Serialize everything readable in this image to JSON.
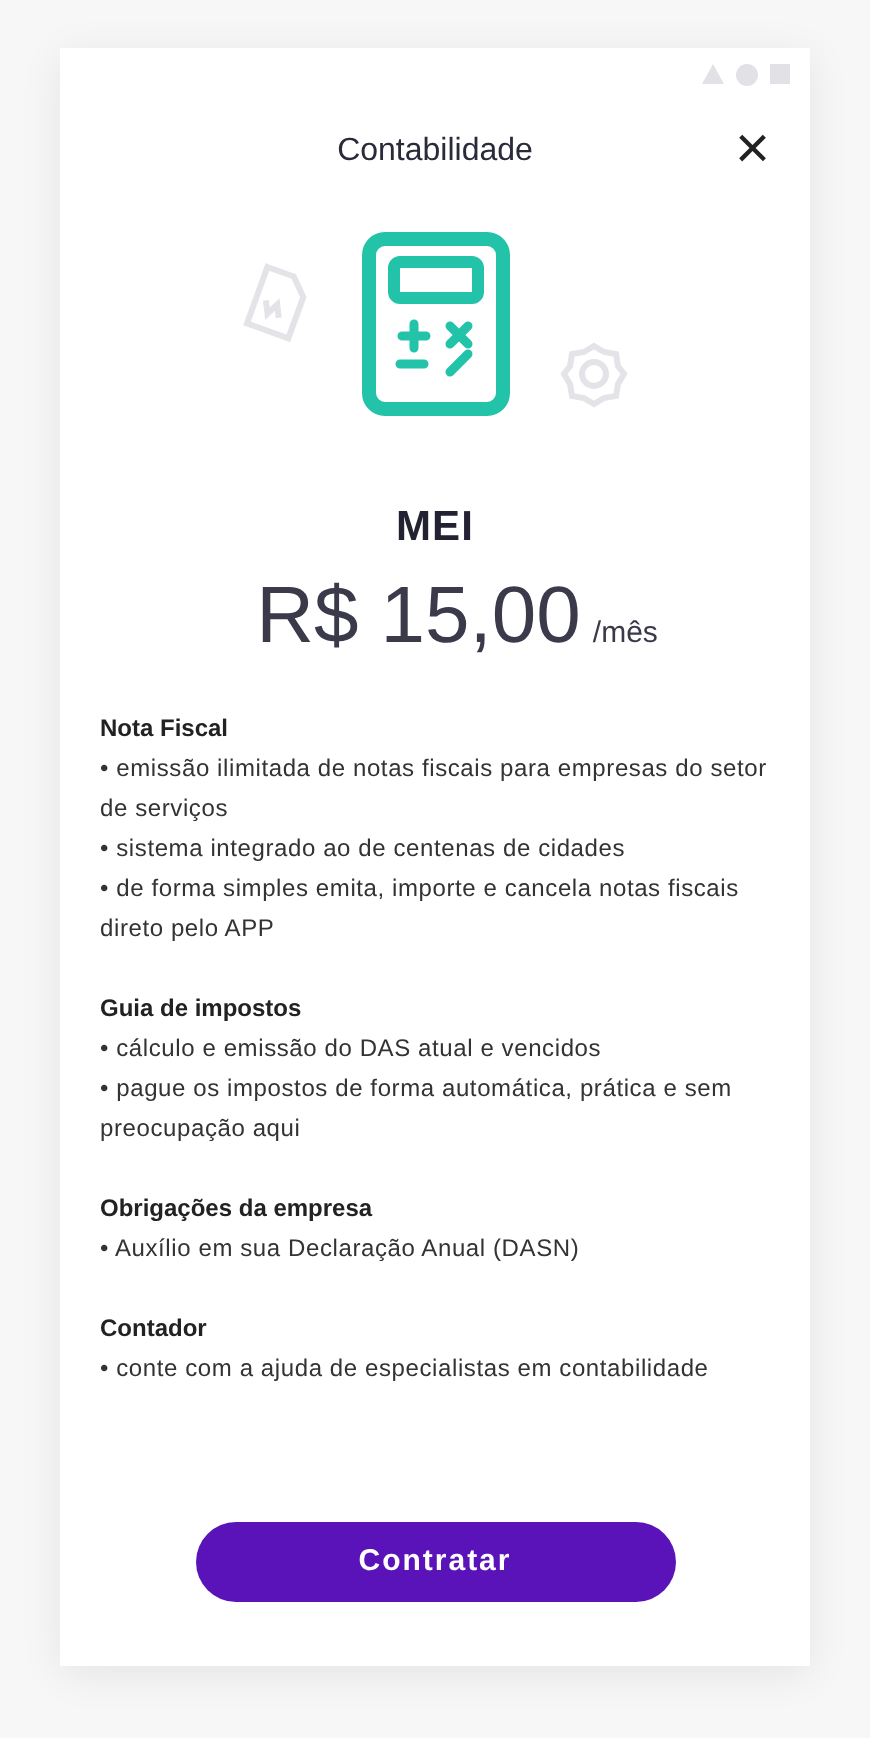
{
  "header": {
    "title": "Contabilidade",
    "close": "×"
  },
  "plan": {
    "name": "MEI",
    "price": "R$ 15,00",
    "period": "/mês"
  },
  "sections": [
    {
      "title": "Nota Fiscal",
      "items": [
        "• emissão ilimitada de notas fiscais para empresas do setor de serviços",
        "• sistema integrado ao de centenas de cidades",
        "• de forma simples emita, importe e cancela notas fiscais direto pelo APP"
      ]
    },
    {
      "title": "Guia de impostos",
      "items": [
        "• cálculo e emissão do DAS atual e vencidos",
        "• pague os impostos de forma automática, prática e sem preocupação aqui"
      ]
    },
    {
      "title": "Obrigações da empresa",
      "items": [
        "• Auxílio em sua Declaração Anual (DASN)"
      ]
    },
    {
      "title": "Contador",
      "items": [
        "• conte com a ajuda de especialistas em contabilidade"
      ]
    }
  ],
  "button": {
    "label": "Contratar"
  }
}
